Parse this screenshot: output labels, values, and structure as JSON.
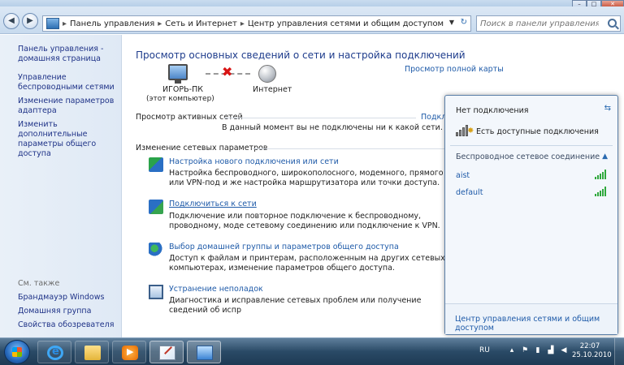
{
  "window": {
    "controls": {
      "minimize": "–",
      "maximize": "□",
      "close": "✕"
    }
  },
  "address": {
    "breadcrumbs": [
      "Панель управления",
      "Сеть и Интернет",
      "Центр управления сетями и общим доступом"
    ],
    "separator": "▸",
    "search_placeholder": "Поиск в панели управления"
  },
  "sidebar": {
    "links": [
      "Панель управления - домашняя страница",
      "Управление беспроводными сетями",
      "Изменение параметров адаптера",
      "Изменить дополнительные параметры общего доступа"
    ],
    "see_also_title": "См. также",
    "see_also": [
      "Брандмауэр Windows",
      "Домашняя группа",
      "Свойства обозревателя"
    ]
  },
  "main": {
    "title": "Просмотр основных сведений о сети и настройка подключений",
    "full_map_link": "Просмотр полной карты",
    "computer_name": "ИГОРЬ-ПК",
    "computer_sub": "(этот компьютер)",
    "internet_label": "Интернет",
    "active_networks_title": "Просмотр активных сетей",
    "connect_link": "Подкл",
    "no_connection_text": "В данный момент вы не подключены ни к какой сети.",
    "change_settings_title": "Изменение сетевых параметров",
    "tasks": [
      {
        "link": "Настройка нового подключения или сети",
        "desc": "Настройка беспроводного, широкополосного, модемного, прямого или VPN-под и же настройка маршрутизатора или точки доступа."
      },
      {
        "link": "Подключиться к сети",
        "desc": "Подключение или повторное подключение к беспроводному, проводному, моде сетевому соединению или подключение к VPN."
      },
      {
        "link": "Выбор домашней группы и параметров общего доступа",
        "desc": "Доступ к файлам и принтерам, расположенным на других сетевых компьютерах, изменение параметров общего доступа."
      },
      {
        "link": "Устранение неполадок",
        "desc": "Диагностика и исправление сетевых проблем или получение сведений об испр"
      }
    ]
  },
  "flyout": {
    "title": "Нет подключения",
    "available": "Есть доступные подключения",
    "wireless_header": "Беспроводное сетевое соединение",
    "networks": [
      "aist",
      "default"
    ],
    "center_link": "Центр управления сетями и общим доступом"
  },
  "taskbar": {
    "language": "RU",
    "time": "22:07",
    "date": "25.10.2010"
  }
}
